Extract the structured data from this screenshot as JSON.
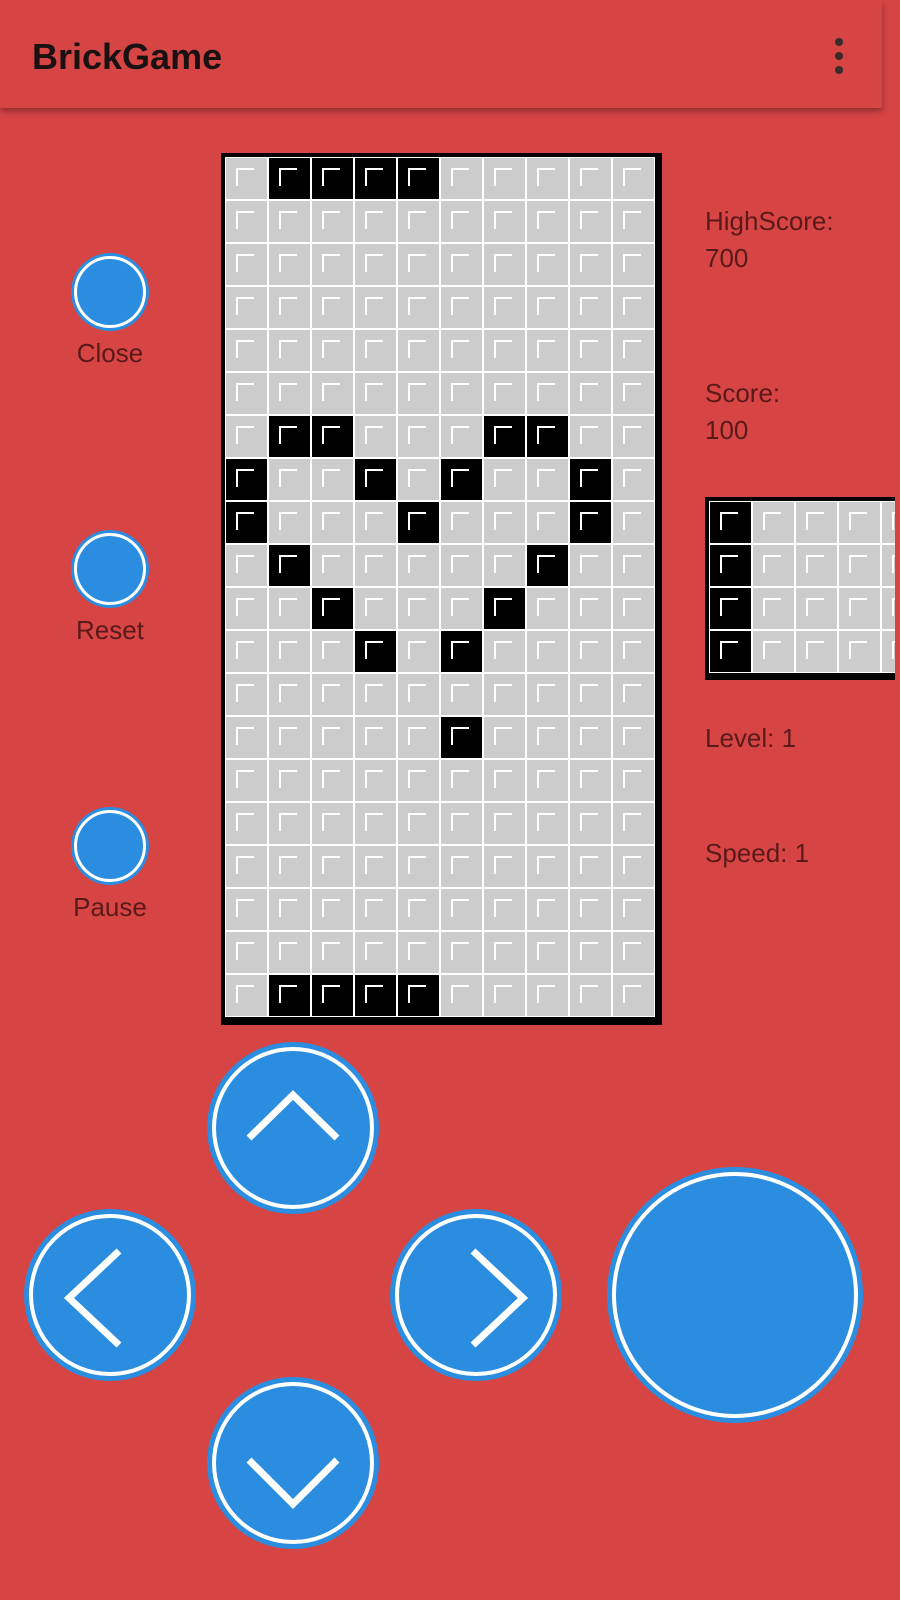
{
  "app": {
    "title": "BrickGame"
  },
  "side_buttons": {
    "close": "Close",
    "reset": "Reset",
    "pause": "Pause"
  },
  "stats": {
    "highscore_label": "HighScore:",
    "highscore_value": "700",
    "score_label": "Score:",
    "score_value": "100",
    "level_label": "Level:",
    "level_value": "1",
    "speed_label": "Speed:",
    "speed_value": "1"
  },
  "board": {
    "rows": [
      "0111100000",
      "0000000000",
      "0000000000",
      "0000000000",
      "0000000000",
      "0000000000",
      "0110001100",
      "1001010010",
      "1000100010",
      "0100000100",
      "0010001000",
      "0001010000",
      "0000000000",
      "0000010000",
      "0000000000",
      "0000000000",
      "0000000000",
      "0000000000",
      "0000000000",
      "0111100000"
    ]
  },
  "next_piece": {
    "rows": [
      "10000",
      "10000",
      "10000",
      "10000"
    ]
  },
  "controls": [
    "up-arrow-icon",
    "left-arrow-icon",
    "right-arrow-icon",
    "down-arrow-icon",
    "action-button"
  ],
  "colors": {
    "background": "#d64444",
    "button": "#2b8de0",
    "cell_off": "#cccccc",
    "cell_on": "#000000"
  }
}
